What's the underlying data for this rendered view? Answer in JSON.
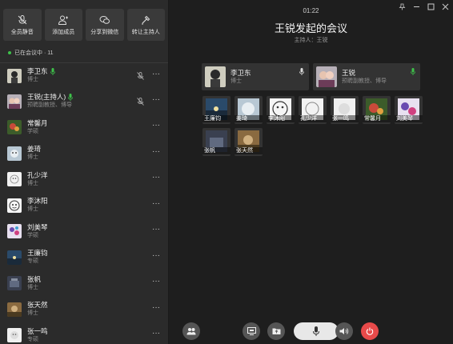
{
  "toolbar": [
    {
      "label": "全员静音",
      "icon": "mute-all-icon"
    },
    {
      "label": "添加成员",
      "icon": "add-member-icon"
    },
    {
      "label": "分享到微信",
      "icon": "wechat-share-icon"
    },
    {
      "label": "转让主持人",
      "icon": "transfer-host-icon"
    }
  ],
  "meeting": {
    "status_label": "已在会议中 · 11",
    "clock": "01:22",
    "title": "王锐发起的会议",
    "host_line": "主持人：王锐"
  },
  "participants": [
    {
      "name": "李卫东",
      "sub": "博士",
      "mic": "on",
      "muted_icon": true
    },
    {
      "name": "王锐(主持人)",
      "sub": "预聘副教授、博导",
      "mic": "on",
      "muted_icon": true
    },
    {
      "name": "常馨月",
      "sub": "学硕"
    },
    {
      "name": "姜琦",
      "sub": "博士"
    },
    {
      "name": "孔少洋",
      "sub": "博士"
    },
    {
      "name": "李沐阳",
      "sub": "博士"
    },
    {
      "name": "刘美琴",
      "sub": "学硕"
    },
    {
      "name": "王廉钧",
      "sub": "专硕"
    },
    {
      "name": "张帆",
      "sub": "博士"
    },
    {
      "name": "张天然",
      "sub": "博士"
    },
    {
      "name": "张一鸣",
      "sub": "专硕"
    }
  ],
  "speakers": [
    {
      "name": "李卫东",
      "sub": "博士"
    },
    {
      "name": "王锐",
      "sub": "预聘副教授、博导"
    }
  ],
  "grid": [
    "王廉钧",
    "姜琦",
    "李沐阳",
    "孔少洋",
    "张一鸣",
    "常馨月",
    "刘美琴",
    "张帆",
    "张天然"
  ],
  "colors": {
    "accent_green": "#3ec24a",
    "hangup_red": "#e84a4a",
    "panel": "#2b2b2b"
  }
}
